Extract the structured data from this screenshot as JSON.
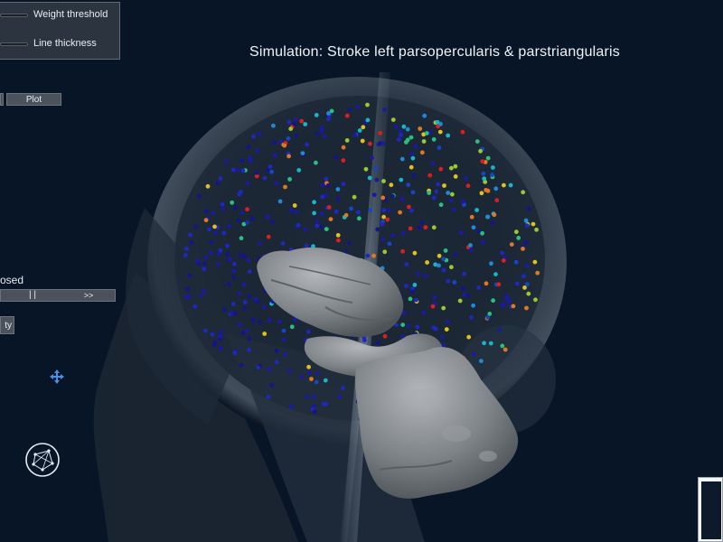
{
  "controls": {
    "weight_threshold_label": "Weight threshold",
    "line_thickness_label": "Line thickness"
  },
  "title": "Simulation: Stroke left parsopercularis & parstriangularis",
  "buttons": {
    "plot_label": "Plot",
    "opacity_label": "ty"
  },
  "playback": {
    "state_label": "osed",
    "pause_label": "| |",
    "forward_label": ">>"
  },
  "icons": {
    "move": "move-arrows-icon",
    "network": "network-graph-icon"
  },
  "colors": {
    "background": "#081526",
    "panel": "#343c46",
    "button": "#4b525b",
    "node_low": "#1a1aa0",
    "node_high": "#e02020",
    "mesh": "#8c9094"
  }
}
